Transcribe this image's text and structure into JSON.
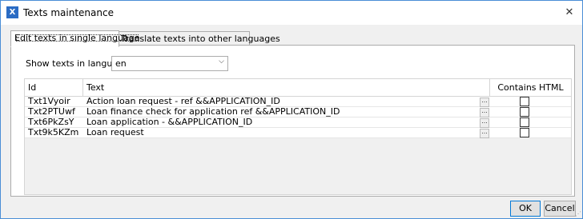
{
  "window": {
    "title": "Texts maintenance",
    "app_icon_letter": "X",
    "close_glyph": "✕"
  },
  "tabs": [
    {
      "label": "Edit texts in single language",
      "active": true
    },
    {
      "label": "Translate texts into other languages",
      "active": false
    }
  ],
  "language": {
    "label": "Show texts in language:",
    "value": "en"
  },
  "grid": {
    "columns": [
      "Id",
      "Text",
      "Contains HTML"
    ],
    "rows": [
      {
        "id": "Txt1Vyoir",
        "text": "Action loan request - ref &&APPLICATION_ID",
        "contains_html": false
      },
      {
        "id": "Txt2PTUwf",
        "text": "Loan finance check for application ref &&APPLICATION_ID",
        "contains_html": false
      },
      {
        "id": "Txt6PkZsY",
        "text": "Loan application - &&APPLICATION_ID",
        "contains_html": false
      },
      {
        "id": "Txt9k5KZm",
        "text": "Loan request",
        "contains_html": false
      }
    ],
    "edit_button_glyph": "..."
  },
  "buttons": {
    "ok": "OK",
    "cancel": "Cancel"
  }
}
